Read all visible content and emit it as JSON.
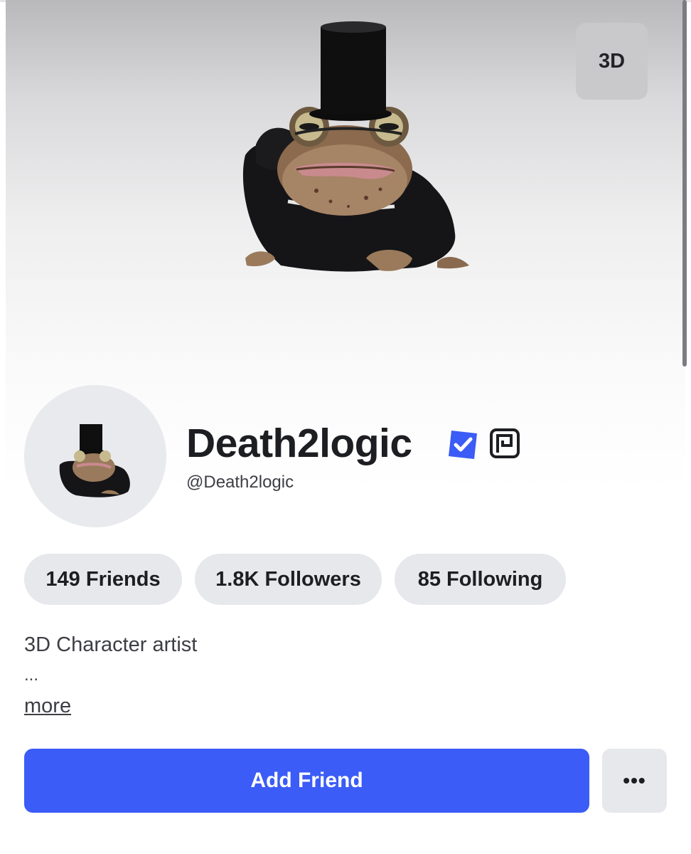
{
  "hero": {
    "view_toggle_label": "3D"
  },
  "profile": {
    "display_name": "Death2logic",
    "username": "@Death2logic",
    "verified_icon": "verified-badge-icon",
    "premium_icon": "premium-icon"
  },
  "stats": {
    "friends": "149 Friends",
    "followers": "1.8K Followers",
    "following": "85 Following"
  },
  "bio": {
    "text": "3D Character artist",
    "ellipsis": "...",
    "more_link": "more"
  },
  "actions": {
    "add_friend_label": "Add Friend",
    "more_options_label": "•••"
  },
  "colors": {
    "primary": "#3b5cf6",
    "pill_bg": "#e7e8eb",
    "verified": "#3b5cf6"
  }
}
